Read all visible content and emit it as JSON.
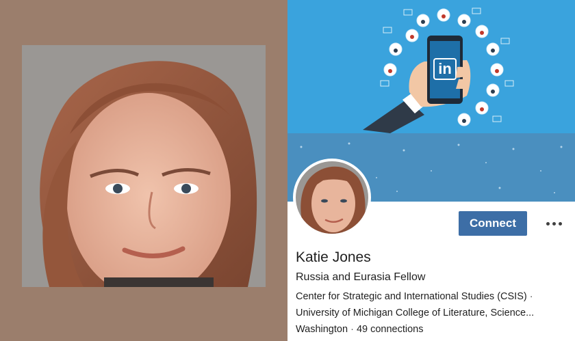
{
  "profile": {
    "name": "Katie Jones",
    "headline": "Russia and Eurasia Fellow",
    "organization": "Center for Strategic and International Studies (CSIS)",
    "education": "University of Michigan College of Literature, Science...",
    "location": "Washington",
    "connections": "49 connections",
    "separator": "·"
  },
  "banner": {
    "logo_text": "in",
    "colors": {
      "sky": "#3aa3dd",
      "lower": "#4a8fbf",
      "phone": "#1e6fa8",
      "sleeve": "#2f3a48"
    }
  },
  "actions": {
    "connect_label": "Connect",
    "more_icon": "more-horizontal-icon",
    "connect_color": "#3d6ea6"
  },
  "background_color": "#9b7e6c"
}
